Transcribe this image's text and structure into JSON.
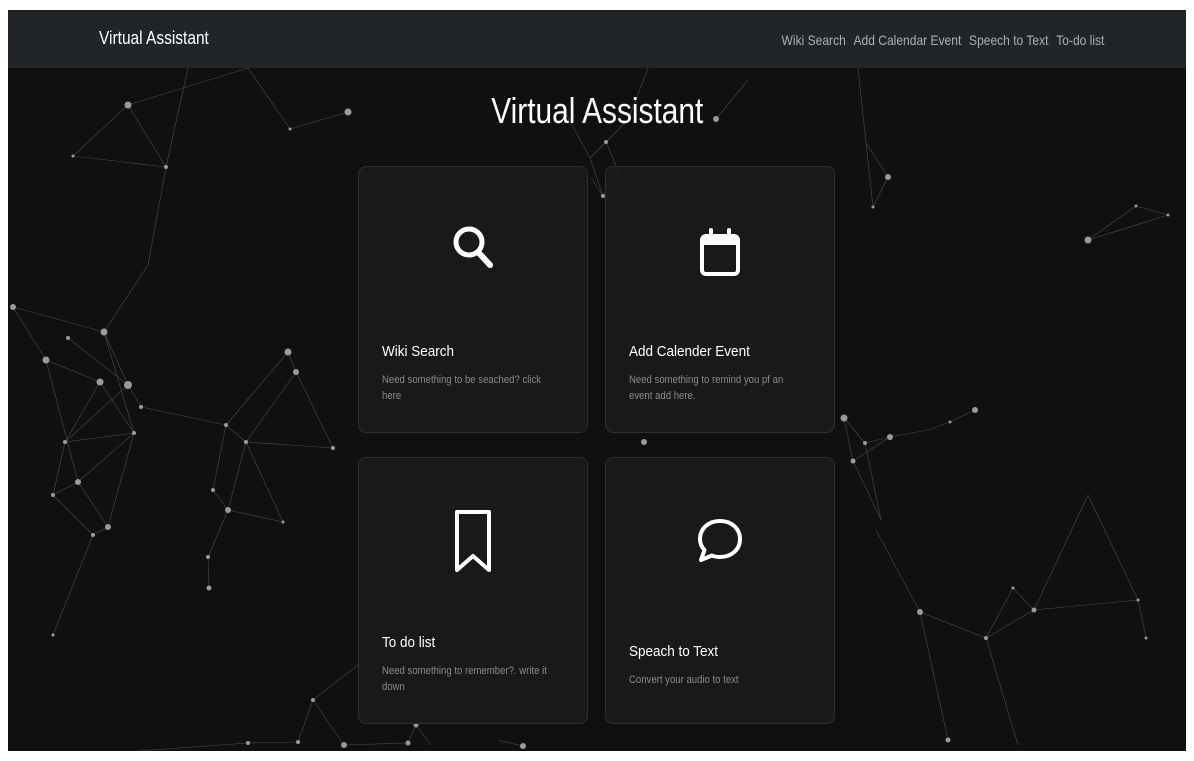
{
  "navbar": {
    "brand": "Virtual Assistant",
    "links": [
      "Wiki Search",
      "Add Calendar Event",
      "Speech to Text",
      "To-do list"
    ]
  },
  "main": {
    "title": "Virtual Assistant",
    "cards": [
      {
        "title": "Wiki Search",
        "text": "Need something to be seached? click here",
        "icon": "search-icon"
      },
      {
        "title": "Add Calender Event",
        "text": "Need something to remind you pf an event add here.",
        "icon": "calendar-icon"
      },
      {
        "title": "To do list",
        "text": "Need something to remember?. write it down",
        "icon": "bookmark-icon"
      },
      {
        "title": "Speach to Text",
        "text": "Convert your audio to text",
        "icon": "chat-bubble-icon"
      }
    ]
  },
  "colors": {
    "background": "#101010",
    "navbar": "#212529",
    "card": "#1a1a1a",
    "text": "#ffffff",
    "muted_text": "#8a8a8a"
  }
}
